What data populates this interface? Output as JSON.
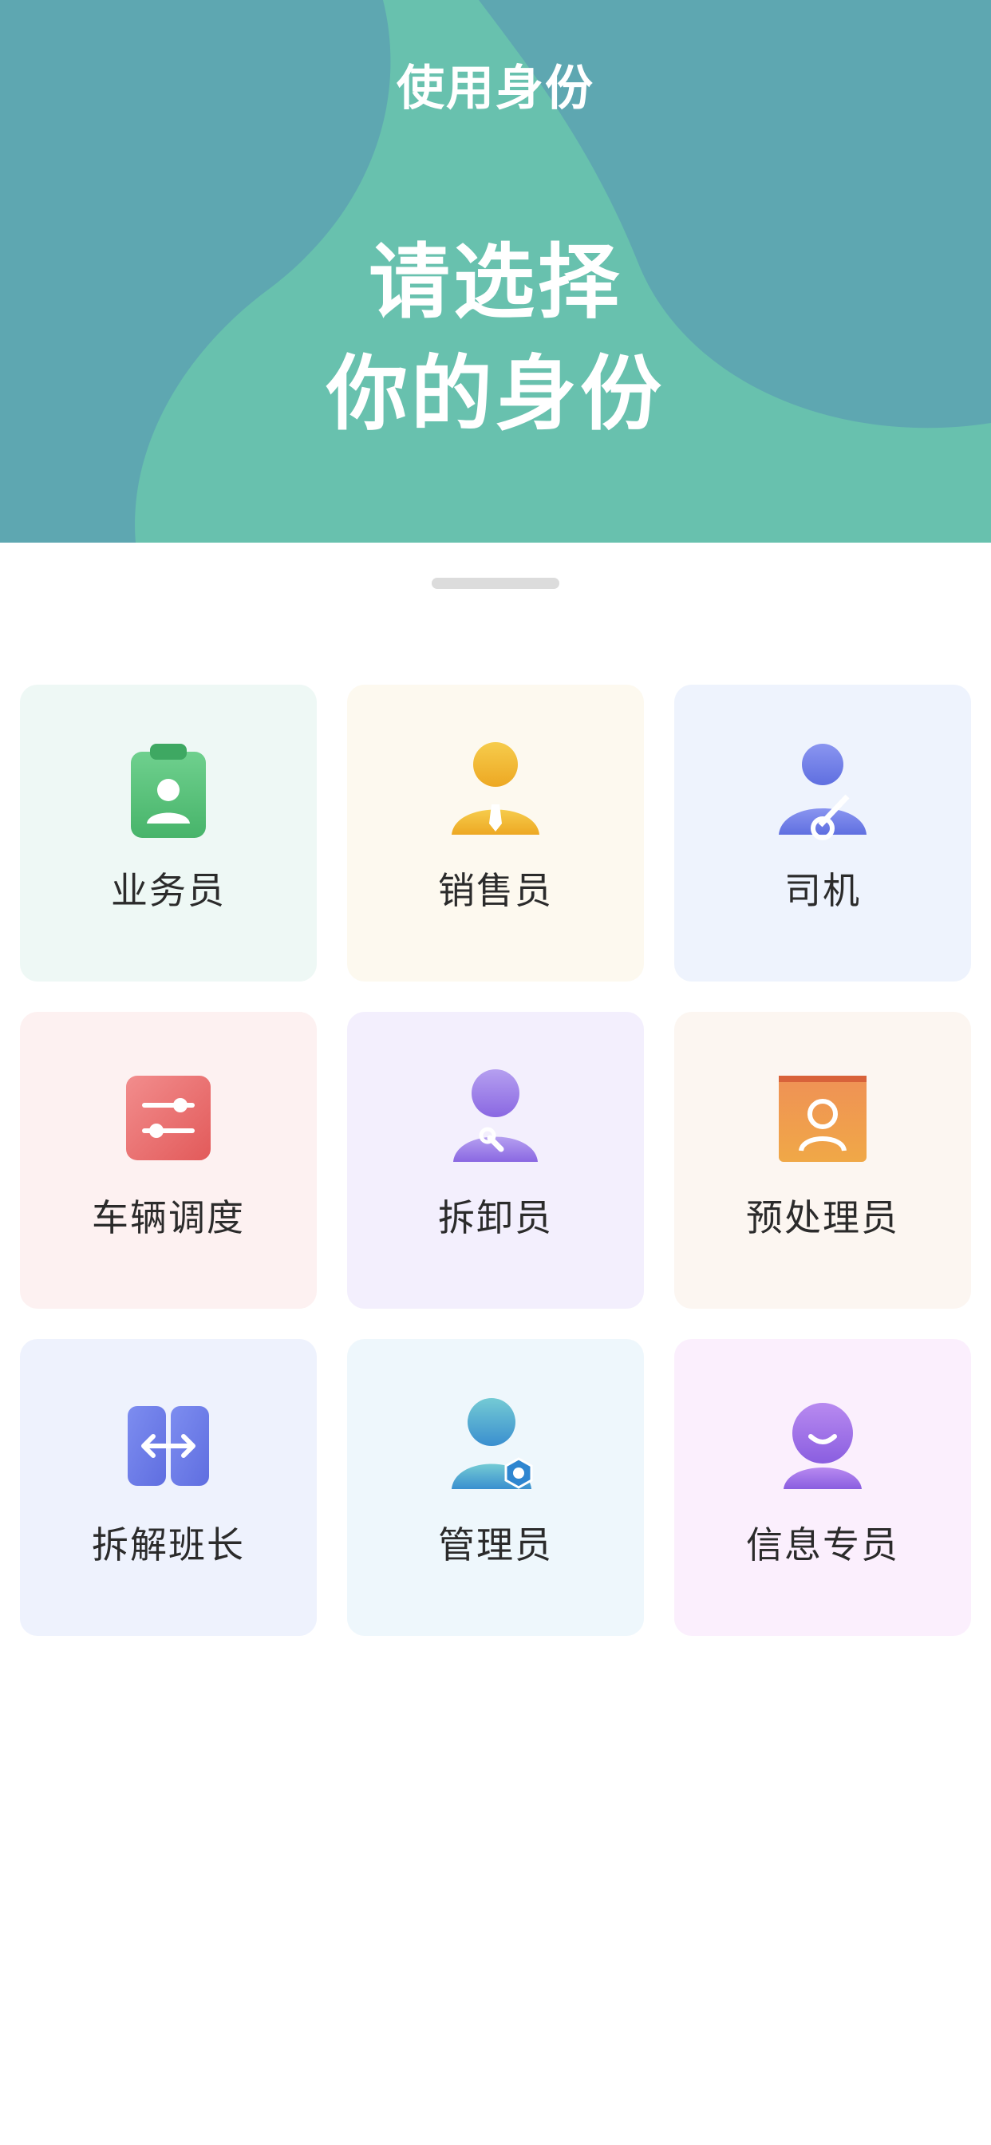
{
  "header": {
    "nav_title": "使用身份",
    "hero_line1": "请选择",
    "hero_line2": "你的身份"
  },
  "roles": [
    {
      "label": "业务员",
      "icon": "clipboard-person-icon",
      "color": "#5cc27e"
    },
    {
      "label": "销售员",
      "icon": "salesperson-tie-icon",
      "color": "#f1b52b"
    },
    {
      "label": "司机",
      "icon": "driver-seatbelt-icon",
      "color": "#6f7de8"
    },
    {
      "label": "车辆调度",
      "icon": "slider-settings-icon",
      "color": "#ec6b6b"
    },
    {
      "label": "拆卸员",
      "icon": "worker-wrench-icon",
      "color": "#9b7ce8"
    },
    {
      "label": "预处理员",
      "icon": "contact-book-icon",
      "color": "#ee8a4a"
    },
    {
      "label": "拆解班长",
      "icon": "split-arrows-icon",
      "color": "#6f82e8"
    },
    {
      "label": "管理员",
      "icon": "admin-gear-icon",
      "color": "#3fa7cf"
    },
    {
      "label": "信息专员",
      "icon": "smiley-person-icon",
      "color": "#a66fe8"
    }
  ]
}
